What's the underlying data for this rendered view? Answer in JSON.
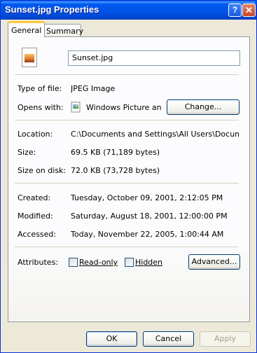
{
  "window": {
    "title": "Sunset.jpg Properties",
    "help_glyph": "?",
    "close_glyph": "✕"
  },
  "tabs": [
    {
      "label": "General",
      "active": true
    },
    {
      "label": "Summary",
      "active": false
    }
  ],
  "file": {
    "icon": "jpeg-file-icon",
    "name": "Sunset.jpg"
  },
  "general": {
    "type_label": "Type of file:",
    "type_value": "JPEG Image",
    "opens_label": "Opens with:",
    "opens_icon": "windows-picture-viewer-icon",
    "opens_value": "Windows Picture and Fax Viewer",
    "change_button": "Change..."
  },
  "location": {
    "location_label": "Location:",
    "location_value": "C:\\Documents and Settings\\All Users\\Documents\\My Pictures\\Sample Pictures",
    "size_label": "Size:",
    "size_value": "69.5 KB (71,189 bytes)",
    "size_disk_label": "Size on disk:",
    "size_disk_value": "72.0 KB (73,728 bytes)"
  },
  "dates": {
    "created_label": "Created:",
    "created_value": "Tuesday, October 09, 2001, 2:12:05 PM",
    "modified_label": "Modified:",
    "modified_value": "Saturday, August 18, 2001, 12:00:00 PM",
    "accessed_label": "Accessed:",
    "accessed_value": "Today, November 22, 2005, 1:00:44 AM"
  },
  "attributes": {
    "label": "Attributes:",
    "readonly_label": "Read-only",
    "readonly_checked": false,
    "hidden_label": "Hidden",
    "hidden_checked": false,
    "advanced_button": "Advanced..."
  },
  "footer": {
    "ok": "OK",
    "cancel": "Cancel",
    "apply": "Apply"
  },
  "colors": {
    "titlebar": "#0054e3",
    "dialog_bg": "#ece9d8",
    "active_tab_accent": "#ffc83c",
    "close_button": "#c8451f"
  }
}
